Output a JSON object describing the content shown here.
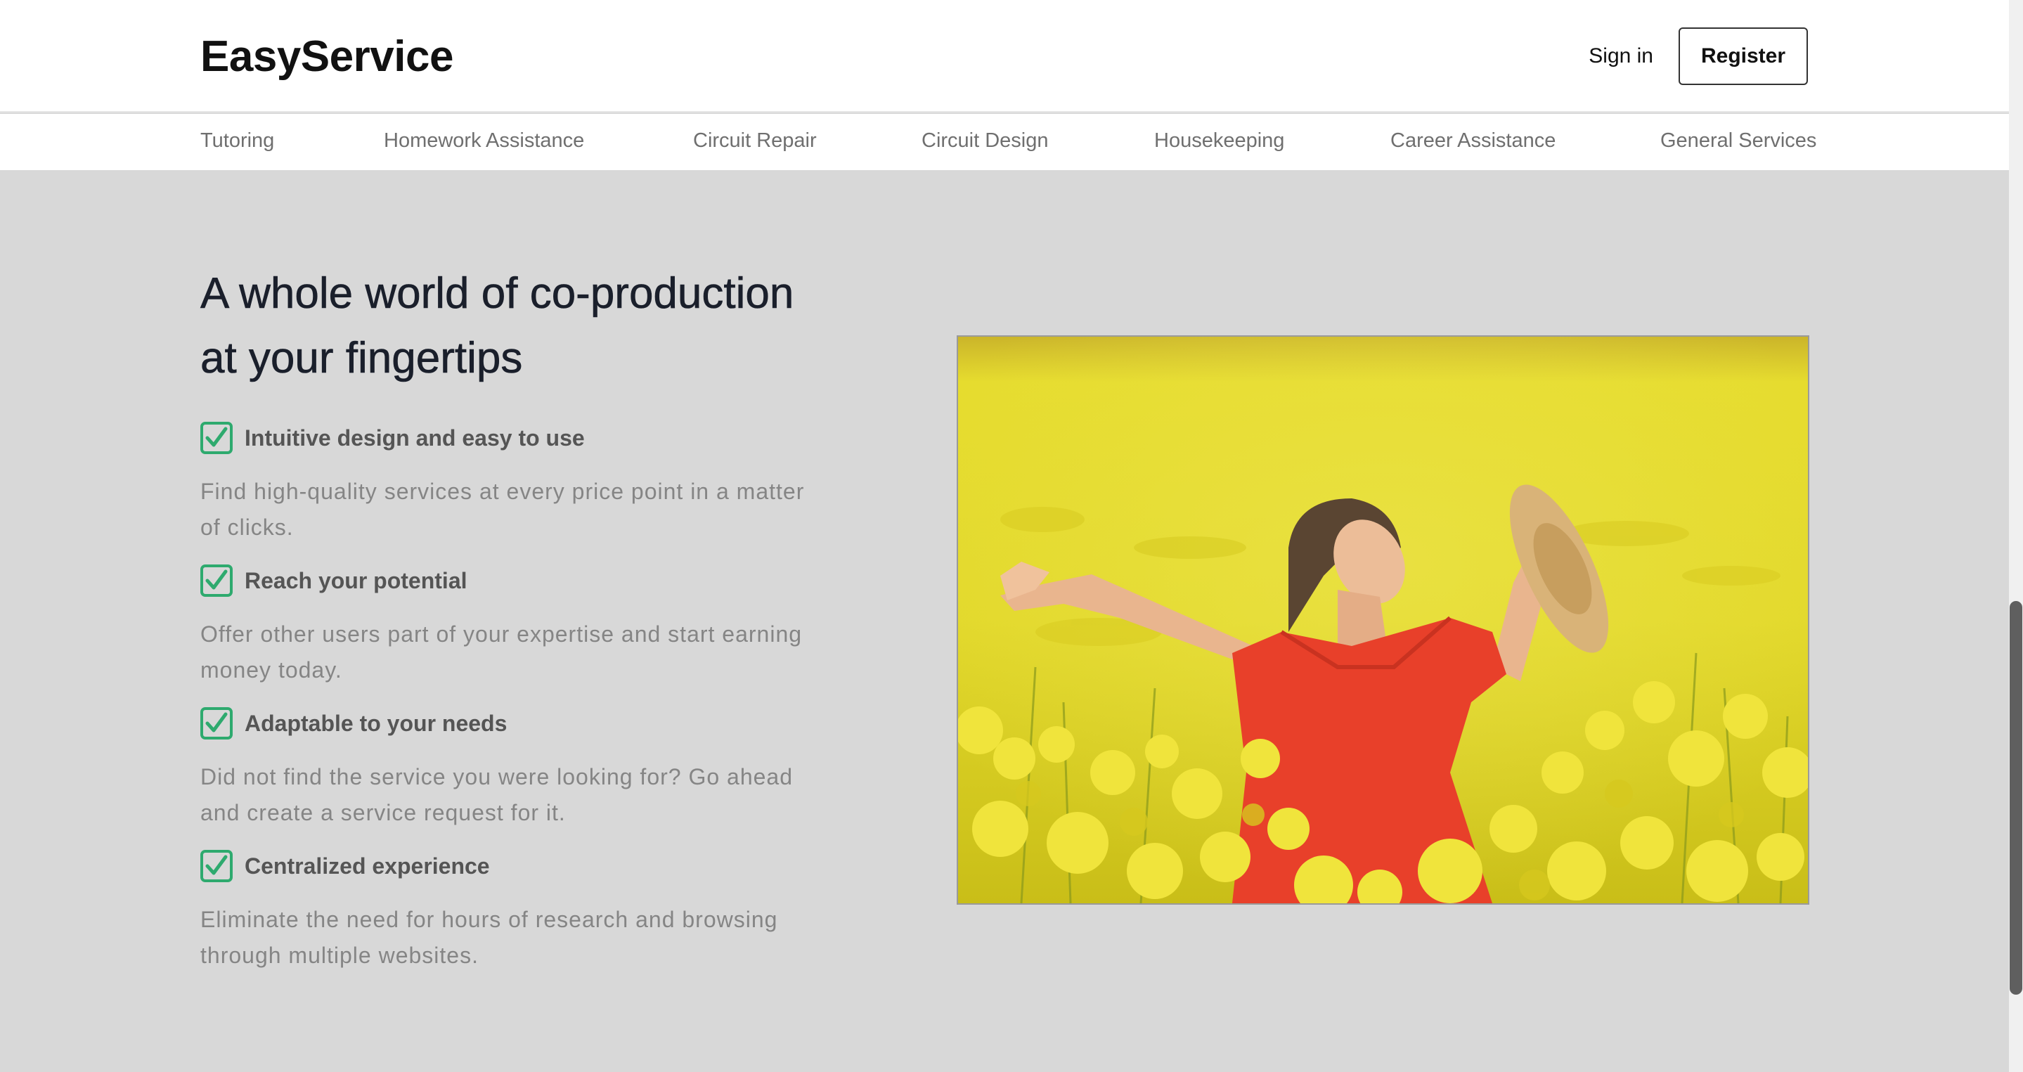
{
  "header": {
    "logo": "EasyService",
    "sign_in": "Sign in",
    "register": "Register"
  },
  "categories": [
    "Tutoring",
    "Homework Assistance",
    "Circuit Repair",
    "Circuit Design",
    "Housekeeping",
    "Career Assistance",
    "General Services"
  ],
  "hero": {
    "headline_line1": "A whole world of co-production",
    "headline_line2": "at your fingertips",
    "features": [
      {
        "title": "Intuitive design and easy to use",
        "desc_line1": "Find high-quality services at every price point in a matter",
        "desc_line2": "of clicks."
      },
      {
        "title": "Reach your potential",
        "desc_line1": "Offer other users part of your expertise and start earning",
        "desc_line2": "money today."
      },
      {
        "title": "Adaptable to your needs",
        "desc_line1": "Did not find the service you were looking for? Go ahead",
        "desc_line2": "and create a service request for it."
      },
      {
        "title": "Centralized experience",
        "desc_line1": "Eliminate the need for hours of research and browsing",
        "desc_line2": "through multiple websites."
      }
    ],
    "photo_icon": "woman-in-rapeseed-field-photo"
  },
  "colors": {
    "check_green": "#2eaa6e",
    "field_yellow": "#e4dc2a",
    "shirt_red": "#e8402a"
  }
}
